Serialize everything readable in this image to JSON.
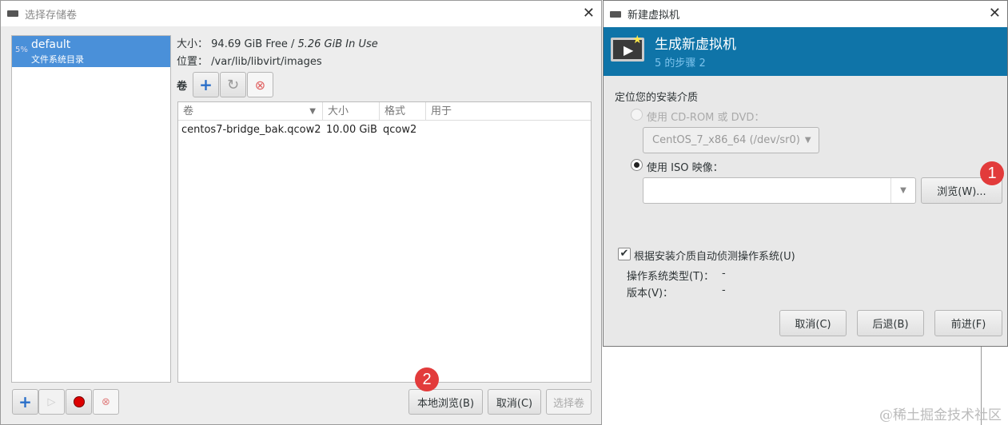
{
  "storage_dialog": {
    "title": "选择存储卷",
    "pool": {
      "usage": "5%",
      "name": "default",
      "type": "文件系统目录"
    },
    "size_label": "大小：",
    "size_free": "94.69 GiB Free",
    "size_sep": " / ",
    "size_used": "5.26 GiB In Use",
    "location_label": "位置：",
    "location": "/var/lib/libvirt/images",
    "volumes_label": "卷",
    "columns": [
      "卷",
      "大小",
      "格式",
      "用于"
    ],
    "rows": [
      {
        "name": "centos7-bridge_bak.qcow2",
        "size": "10.00 GiB",
        "format": "qcow2",
        "used_by": ""
      }
    ],
    "buttons": {
      "browse_local": "本地浏览(B)",
      "cancel": "取消(C)",
      "choose": "选择卷"
    },
    "badge": "2"
  },
  "new_vm_dialog": {
    "title": "新建虚拟机",
    "header_title": "生成新虚拟机",
    "step": "5 的步骤 2",
    "section": "定位您的安装介质",
    "cdrom_label": "使用 CD-ROM 或 DVD：",
    "cdrom_value": "CentOS_7_x86_64 (/dev/sr0)",
    "iso_label": "使用 ISO 映像：",
    "iso_value": "",
    "browse": "浏览(W)...",
    "badge": "1",
    "autodetect": "根据安装介质自动侦测操作系统(U)",
    "os_type_label": "操作系统类型(T)：",
    "os_type": "-",
    "version_label": "版本(V)：",
    "version": "-",
    "buttons": {
      "cancel": "取消(C)",
      "back": "后退(B)",
      "forward": "前进(F)"
    }
  },
  "watermark": "@稀土掘金技术社区"
}
